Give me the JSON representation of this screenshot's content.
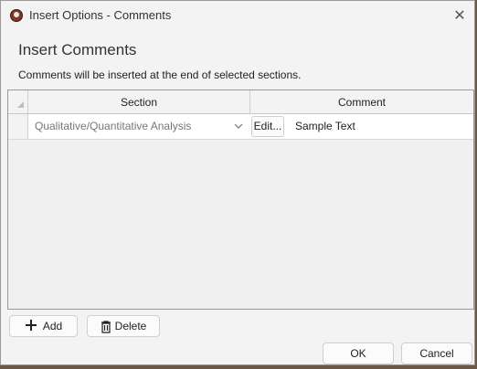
{
  "window": {
    "title": "Insert Options - Comments",
    "close_glyph": "✕",
    "icons": {
      "app": "app-logo-icon",
      "close": "close-icon"
    }
  },
  "heading": "Insert Comments",
  "description": "Comments will be inserted at the end of selected sections.",
  "grid": {
    "columns": [
      "Section",
      "Comment"
    ],
    "rows": [
      {
        "section": "Qualitative/Quantitative Analysis",
        "edit_label": "Edit...",
        "comment": "Sample Text"
      }
    ]
  },
  "buttons": {
    "add": "Add",
    "delete": "Delete",
    "ok": "OK",
    "cancel": "Cancel"
  }
}
